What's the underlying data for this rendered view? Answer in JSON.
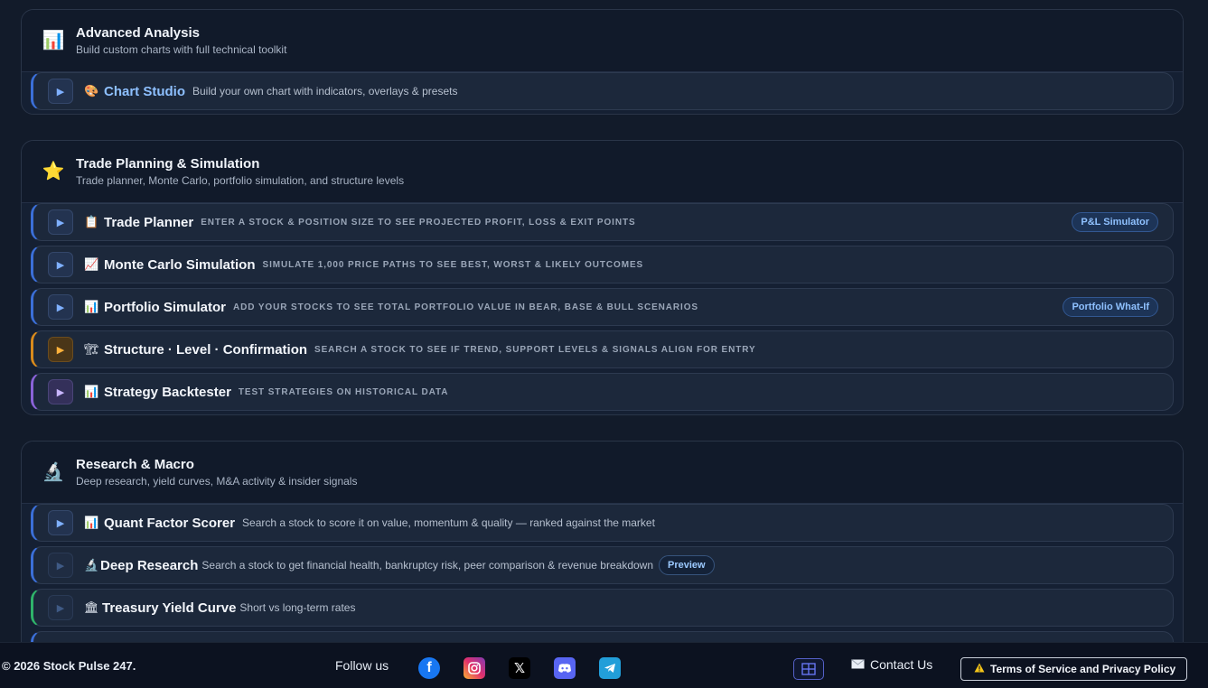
{
  "sections": [
    {
      "title": "Advanced Analysis",
      "subtitle": "Build custom charts with full technical toolkit",
      "icon": "bar-chart-icon",
      "rows": [
        {
          "title": "Chart Studio",
          "desc": "Build your own chart with indicators, overlays & presets",
          "icon": "palette-icon"
        }
      ]
    },
    {
      "title": "Trade Planning & Simulation",
      "subtitle": "Trade planner, Monte Carlo, portfolio simulation, and structure levels",
      "icon": "star-icon",
      "rows": [
        {
          "title": "Trade Planner",
          "desc": "Enter a stock & position size to see projected profit, loss & exit points",
          "badge": "P&L Simulator",
          "icon": "clipboard-icon"
        },
        {
          "title": "Monte Carlo Simulation",
          "desc": "Simulate 1,000 price paths to see best, worst & likely outcomes",
          "icon": "trend-chart-icon"
        },
        {
          "title": "Portfolio Simulator",
          "desc": "Add your stocks to see total portfolio value in bear, base & bull scenarios",
          "badge": "Portfolio What-If",
          "icon": "bar-chart-icon"
        },
        {
          "title": "Structure · Level · Confirmation",
          "desc": "Search a stock to see if trend, support levels & signals align for entry",
          "icon": "crane-icon"
        },
        {
          "title": "Strategy Backtester",
          "desc": "Test strategies on historical data",
          "icon": "bar-chart-icon"
        }
      ]
    },
    {
      "title": "Research & Macro",
      "subtitle": "Deep research, yield curves, M&A activity & insider signals",
      "icon": "microscope-icon",
      "rows": [
        {
          "title": "Quant Factor Scorer",
          "desc": "Search a stock to score it on value, momentum & quality — ranked against the market",
          "icon": "bar-chart-icon"
        },
        {
          "title": "Deep Research",
          "desc": "Search a stock to get financial health, bankruptcy risk, peer comparison & revenue breakdown",
          "badge": "Preview",
          "icon": "microscope-icon"
        },
        {
          "title": "Treasury Yield Curve",
          "desc": "Short vs long-term rates",
          "icon": "bank-icon"
        }
      ]
    }
  ],
  "footer": {
    "copyright": "© 2026 Stock Pulse 247.",
    "follow_label": "Follow us",
    "social": [
      "facebook-icon",
      "instagram-icon",
      "x-icon",
      "discord-icon",
      "telegram-icon"
    ],
    "contact_label": "Contact Us",
    "terms_label": "Terms of Service and Privacy Policy"
  },
  "colors": {
    "background": "#121b2a",
    "card": "#1c283b",
    "accent_blue": "#3b6fd8",
    "accent_orange": "#d98a1c",
    "accent_purple": "#8a63d8",
    "accent_green": "#2fb36a"
  }
}
